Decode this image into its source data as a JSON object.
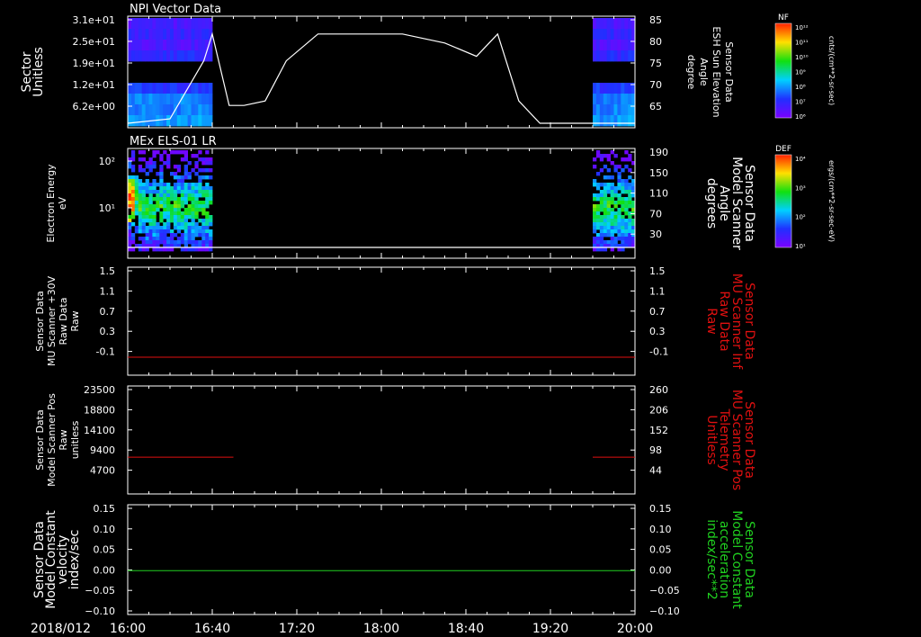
{
  "colors": {
    "red": "#e01010",
    "green": "#20d020",
    "white": "#ffffff",
    "background": "#000000"
  },
  "date_label": "2018/012",
  "time_ticks": [
    "16:00",
    "16:40",
    "17:20",
    "18:00",
    "18:40",
    "19:20",
    "20:00"
  ],
  "colorbars": [
    {
      "label": "NF",
      "unit": "cnts/(cm**2-sr-sec)",
      "ticks": [
        "10¹²",
        "10¹¹",
        "10¹⁰",
        "10⁹",
        "10⁸",
        "10⁷",
        "10⁶"
      ]
    },
    {
      "label": "DEF",
      "unit": "ergs/(cm**2-sr-sec-eV)",
      "ticks": [
        "10⁴",
        "10³",
        "10²",
        "10¹"
      ]
    }
  ],
  "chart_data": [
    {
      "type": "heatmap",
      "title": "NPI Vector Data",
      "left_axis_label": [
        "Sector",
        "Unitless"
      ],
      "left_ticks": [
        "3.1e+01",
        "2.5e+01",
        "1.9e+01",
        "1.2e+01",
        "6.2e+00"
      ],
      "right_axis_label": [
        "Sensor Data",
        "ESH Sun Elevation",
        "Angle",
        "degree"
      ],
      "right_ticks": [
        "85",
        "80",
        "75",
        "70",
        "65"
      ],
      "right_ylim": [
        60,
        85
      ],
      "data_windows": [
        [
          "16:00",
          "16:40"
        ],
        [
          "19:40",
          "20:00"
        ]
      ],
      "overlay_line": {
        "color": "#ffffff",
        "x": [
          "16:00",
          "16:20",
          "16:36",
          "16:40",
          "16:48",
          "16:55",
          "17:05",
          "17:15",
          "17:30",
          "18:10",
          "18:30",
          "18:45",
          "18:55",
          "19:05",
          "19:15",
          "20:00"
        ],
        "y": [
          61,
          62,
          75,
          81,
          65,
          65,
          66,
          75,
          81,
          81,
          79,
          76,
          81,
          66,
          61,
          61
        ]
      }
    },
    {
      "type": "heatmap",
      "title": "MEx ELS-01 LR",
      "left_axis_label": [
        "Electron Energy",
        "eV"
      ],
      "left_ticks": [
        "10²",
        "10¹"
      ],
      "right_axis_label": [
        "Sensor Data",
        "Model Scanner",
        "Angle",
        "degrees"
      ],
      "right_ticks": [
        "190",
        "150",
        "110",
        "70",
        "30"
      ],
      "data_windows": [
        [
          "16:00",
          "16:40"
        ],
        [
          "19:40",
          "20:00"
        ]
      ],
      "overlay_line": {
        "color": "#ffffff",
        "x": [
          "16:00",
          "20:00"
        ],
        "y": [
          5,
          5
        ]
      }
    },
    {
      "type": "line",
      "left_axis_label": [
        "Sensor Data",
        "MU Scanner +30V",
        "Raw Data",
        "Raw"
      ],
      "left_ticks": [
        "1.5",
        "1.1",
        "0.7",
        "0.3",
        "-0.1"
      ],
      "right_axis_label": [
        "Sensor Data",
        "MU Scanner Inf",
        "Raw Data",
        "Raw"
      ],
      "right_ticks": [
        "1.5",
        "1.1",
        "0.7",
        "0.3",
        "-0.1"
      ],
      "ylim": [
        -0.3,
        1.5
      ],
      "series": [
        {
          "color": "#e01010",
          "x": [
            "16:00",
            "20:00"
          ],
          "y": [
            0,
            0
          ]
        }
      ]
    },
    {
      "type": "line",
      "left_axis_label": [
        "Sensor Data",
        "Model Scanner Pos",
        "Raw",
        "unitless"
      ],
      "left_ticks": [
        "23500",
        "18800",
        "14100",
        "9400",
        "4700"
      ],
      "right_axis_label": [
        "Sensor Data",
        "MU Scanner Pos",
        "Telemetry",
        "Unitless"
      ],
      "right_ticks": [
        "260",
        "206",
        "152",
        "98",
        "44"
      ],
      "ylim": [
        0,
        23500
      ],
      "series": [
        {
          "color": "#e01010",
          "x": [
            "16:00",
            "16:50"
          ],
          "y": [
            8000,
            8000
          ]
        },
        {
          "color": "#e01010",
          "x": [
            "19:40",
            "20:00"
          ],
          "y": [
            8000,
            8000
          ]
        }
      ]
    },
    {
      "type": "line",
      "left_axis_label": [
        "Sensor Data",
        "Model Constant",
        "velocity",
        "index/sec"
      ],
      "left_ticks": [
        "0.15",
        "0.10",
        "0.05",
        "0.00",
        "−0.05",
        "−0.10"
      ],
      "right_axis_label": [
        "Sensor Data",
        "Model Constant",
        "acceleration",
        "index/sec**2"
      ],
      "right_ticks": [
        "0.15",
        "0.10",
        "0.05",
        "0.00",
        "−0.05",
        "−0.10"
      ],
      "ylim": [
        -0.1,
        0.15
      ],
      "series": [
        {
          "color": "#20d020",
          "x": [
            "16:00",
            "20:00"
          ],
          "y": [
            0,
            0
          ]
        }
      ]
    }
  ]
}
